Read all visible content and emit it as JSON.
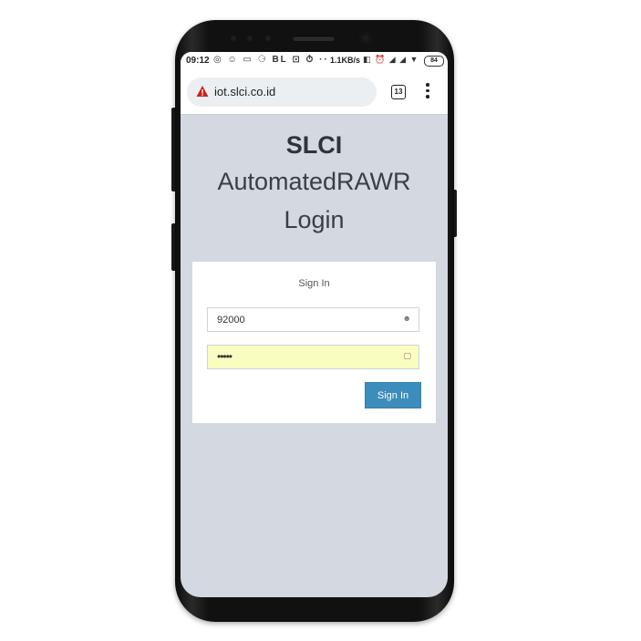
{
  "status_bar": {
    "time": "09:12",
    "notification_icons": "◎ ☺ ▭ ⚆ BL ⊡ ⏱ ··",
    "network_speed": "1.1KB/s",
    "system_icons": "◧ ⏰ ◢ ◢ ▼",
    "battery": "84"
  },
  "browser": {
    "security_icon": "warning-icon",
    "url": "iot.slci.co.id",
    "tab_count": "13",
    "menu_icon": "more-vertical-icon"
  },
  "page": {
    "brand": "SLCI",
    "app_name": "AutomatedRAWR",
    "heading": "Login",
    "form": {
      "title": "Sign In",
      "username_value": "92000",
      "username_icon": "user-icon",
      "password_value": "•••••",
      "password_icon": "lock-icon",
      "submit_label": "Sign In"
    }
  },
  "colors": {
    "page_background": "#d4d8e0",
    "button_primary": "#3c8dbc",
    "autofill_yellow": "#fafdc0",
    "warning_red": "#c5221f"
  }
}
